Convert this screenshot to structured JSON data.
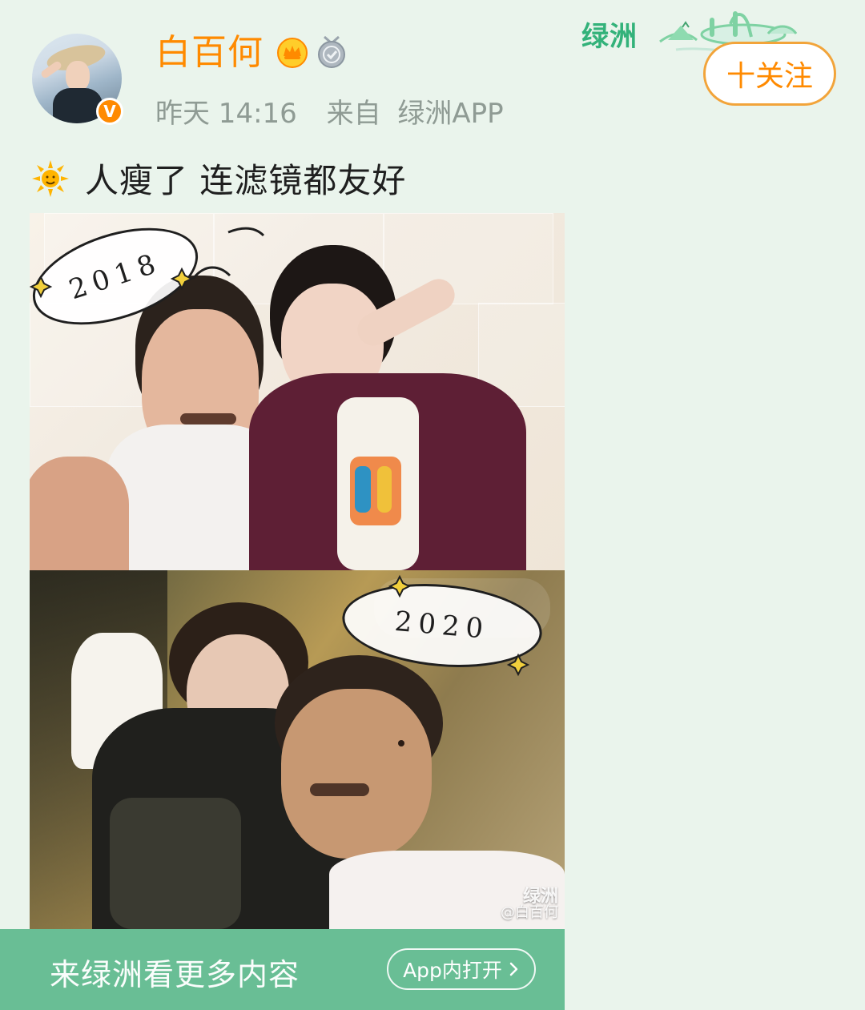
{
  "header": {
    "username": "白百何",
    "timestamp": "昨天 14:16",
    "source_prefix": "来自",
    "source_name": "绿洲APP",
    "follow_label": "十关注",
    "brand_logo_text": "绿洲"
  },
  "post": {
    "text": "人瘦了 连滤镜都友好",
    "image": {
      "top_year": "2018",
      "bottom_year": "2020",
      "watermark_brand": "绿洲",
      "watermark_handle": "@白百何"
    }
  },
  "banner": {
    "text": "来绿洲看更多内容",
    "open_button": "App内打开"
  },
  "icons": {
    "verified": "verified-icon",
    "vip": "vip-crown-icon",
    "answer": "answer-badge-icon",
    "sun": "sun-icon",
    "arrow": "chevron-right-icon"
  },
  "colors": {
    "background": "#eaf4ec",
    "accent": "#ff8a00",
    "brand_green": "#69be95",
    "meta_gray": "#8f9b94"
  }
}
